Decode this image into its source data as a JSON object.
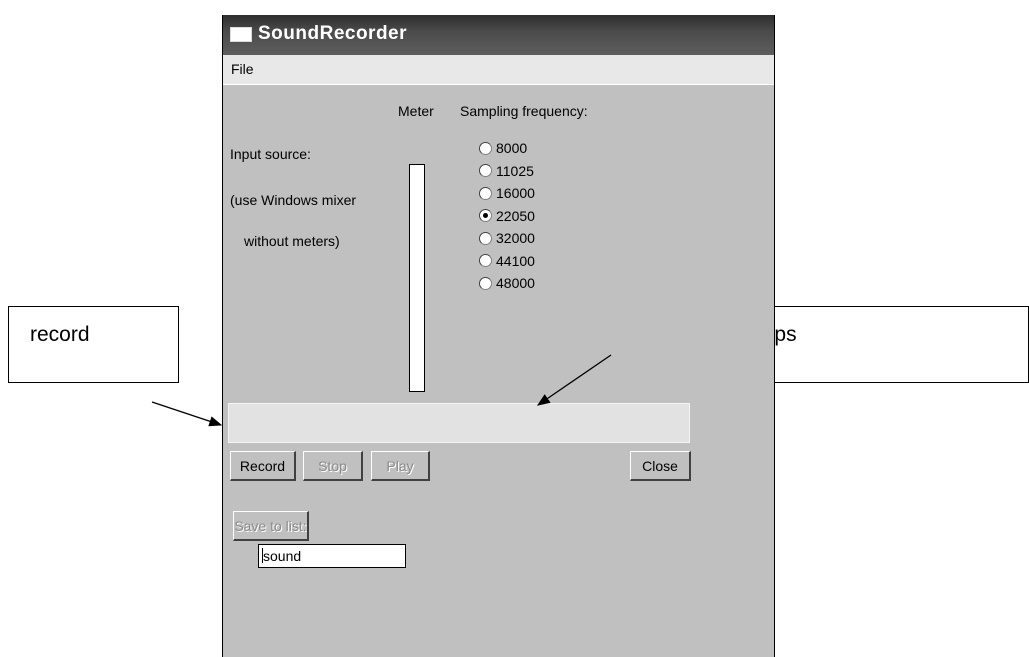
{
  "window": {
    "title": "SoundRecorder",
    "menu": {
      "file_label": "File"
    }
  },
  "labels": {
    "meter": "Meter",
    "sampling_frequency": "Sampling frequency:",
    "input_source": "Input source:",
    "mixer_note_line1": "(use Windows mixer",
    "mixer_note_line2": "without meters)"
  },
  "frequencies": {
    "options": [
      "8000",
      "11025",
      "16000",
      "22050",
      "32000",
      "44100",
      "48000"
    ],
    "selected": "22050"
  },
  "buttons": {
    "record": "Record",
    "stop": "Stop",
    "play": "Play",
    "close": "Close",
    "save_to_list": "Save to list:"
  },
  "name_field": {
    "value": "sound"
  },
  "annotations": {
    "record_label": "record",
    "time_bar_label": "Barre du temps"
  }
}
